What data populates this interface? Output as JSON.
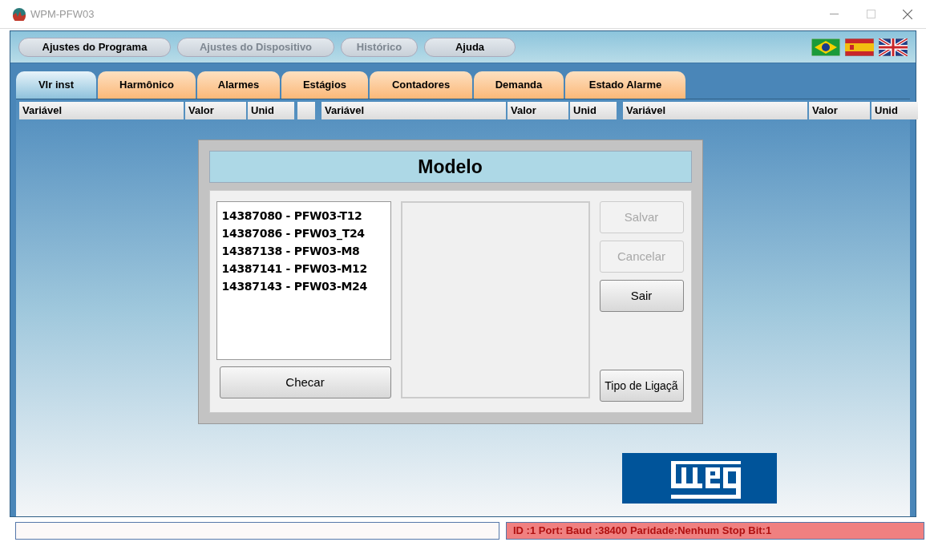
{
  "window": {
    "title": "WPM-PFW03"
  },
  "menu": [
    {
      "label": "Ajustes do Programa",
      "disabled": false
    },
    {
      "label": "Ajustes do Dispositivo",
      "disabled": true
    },
    {
      "label": "Histórico",
      "disabled": true
    },
    {
      "label": "Ajuda",
      "disabled": false
    }
  ],
  "tabs": [
    {
      "label": "Vlr inst",
      "selected": true
    },
    {
      "label": "Harmônico",
      "selected": false
    },
    {
      "label": "Alarmes",
      "selected": false
    },
    {
      "label": "Estágios",
      "selected": false
    },
    {
      "label": "Contadores",
      "selected": false
    },
    {
      "label": "Demanda",
      "selected": false
    },
    {
      "label": "Estado Alarme",
      "selected": false
    }
  ],
  "table": {
    "column_groups": [
      [
        "Variável",
        "Valor",
        "Unid"
      ],
      [
        "Variável",
        "Valor",
        "Unid"
      ],
      [
        "Variável",
        "Valor",
        "Unid"
      ]
    ]
  },
  "dialog": {
    "title": "Modelo",
    "models": [
      "14387080 - PFW03-T12",
      "14387086 - PFW03_T24",
      "14387138 - PFW03-M8",
      "14387141 - PFW03-M12",
      "14387143 - PFW03-M24"
    ],
    "check_button": "Checar",
    "buttons": [
      {
        "label": "Salvar",
        "disabled": true
      },
      {
        "label": "Cancelar",
        "disabled": true
      },
      {
        "label": "Sair",
        "disabled": false
      }
    ],
    "connection_button": "Tipo de Ligaçã"
  },
  "status_bar": {
    "connection": "ID :1 Port: Baud :38400 Paridade:Nenhum Stop Bit:1"
  }
}
